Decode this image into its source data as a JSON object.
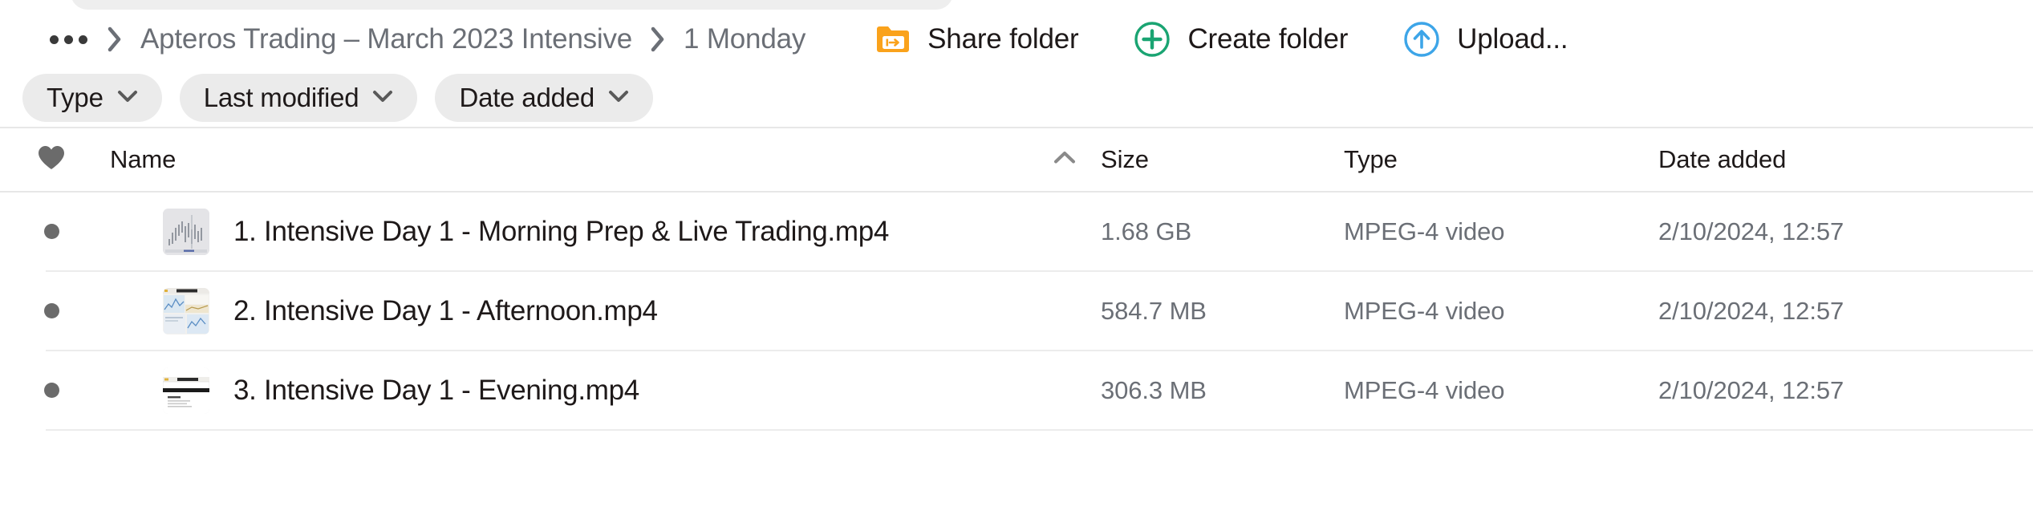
{
  "breadcrumb": {
    "overflow_label": "•••",
    "separator": "chevron-right-icon",
    "items": [
      {
        "label": "Apteros Trading – March 2023 Intensive"
      },
      {
        "label": "1 Monday"
      }
    ]
  },
  "actions": [
    {
      "label": "Share folder",
      "icon": "share-folder-icon",
      "color": "#faa21b"
    },
    {
      "label": "Create folder",
      "icon": "plus-circle-icon",
      "color": "#1aa472"
    },
    {
      "label": "Upload...",
      "icon": "upload-circle-icon",
      "color": "#3da5e8"
    }
  ],
  "filters": [
    {
      "label": "Type",
      "icon": "chevron-down-icon"
    },
    {
      "label": "Last modified",
      "icon": "chevron-down-icon"
    },
    {
      "label": "Date added",
      "icon": "chevron-down-icon"
    }
  ],
  "table": {
    "columns": {
      "favorite": "heart-icon",
      "name": "Name",
      "size": "Size",
      "type": "Type",
      "date_added": "Date added"
    },
    "sort": {
      "column": "Name",
      "direction": "ascending",
      "icon": "chevron-up-icon"
    },
    "rows": [
      {
        "favorite_marker": "dot-icon",
        "thumbnail": "candlestick-chart-thumbnail",
        "name": "1. Intensive Day 1 - Morning Prep & Live Trading.mp4",
        "size": "1.68 GB",
        "type": "MPEG-4 video",
        "date_added": "2/10/2024, 12:57"
      },
      {
        "favorite_marker": "dot-icon",
        "thumbnail": "trading-desk-thumbnail",
        "name": "2. Intensive Day 1 - Afternoon.mp4",
        "size": "584.7 MB",
        "type": "MPEG-4 video",
        "date_added": "2/10/2024, 12:57"
      },
      {
        "favorite_marker": "dot-icon",
        "thumbnail": "document-slide-thumbnail",
        "name": "3. Intensive Day 1 - Evening.mp4",
        "size": "306.3 MB",
        "type": "MPEG-4 video",
        "date_added": "2/10/2024, 12:57"
      }
    ]
  },
  "colors": {
    "text_primary": "#1e1919",
    "text_secondary": "#6b6f76",
    "chip_bg": "#ebebeb",
    "rule": "#e7e7e7",
    "share": "#faa21b",
    "create": "#1aa472",
    "upload": "#3da5e8"
  }
}
